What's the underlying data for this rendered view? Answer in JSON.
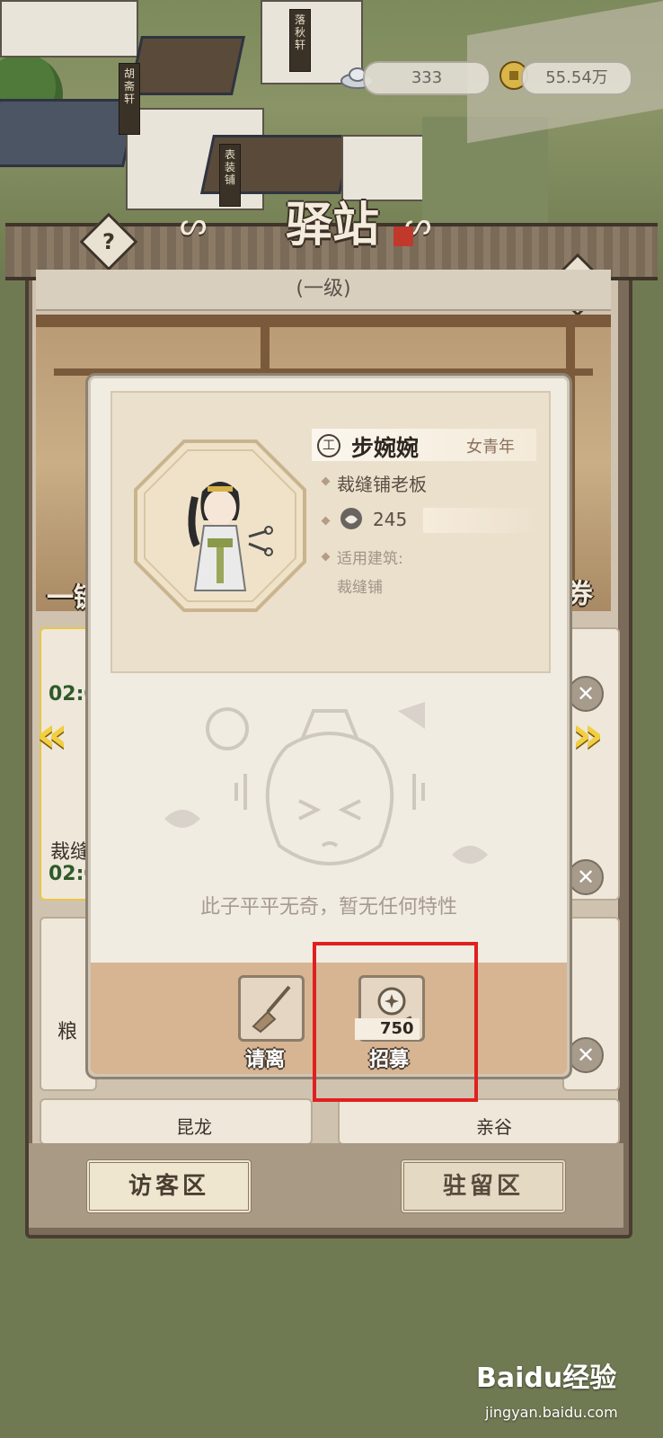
{
  "resources": {
    "silver_value": "333",
    "coins_value": "55.54万"
  },
  "building": {
    "title": "驿站",
    "level": "(一级)"
  },
  "background": {
    "left_label": "一键",
    "right_label": "券",
    "timer": "02:0",
    "list_label_1": "裁缝",
    "list_label_2": "粮",
    "bottom_card_1": "昆龙",
    "bottom_card_2": "亲谷"
  },
  "zones": {
    "visitor": "访客区",
    "stay": "驻留区"
  },
  "visitor": {
    "type_glyph": "工",
    "name": "步婉婉",
    "age_group": "女青年",
    "occupation": "裁缝铺老板",
    "value": "245",
    "applicable_label": "适用建筑:",
    "applicable_building": "裁缝铺",
    "trait_text": "此子平平无奇，暂无任何特性"
  },
  "actions": {
    "dismiss": "请离",
    "recruit": "招募",
    "recruit_cost": "750"
  },
  "watermark": {
    "brand": "Baidu经验",
    "url": "jingyan.baidu.com"
  }
}
